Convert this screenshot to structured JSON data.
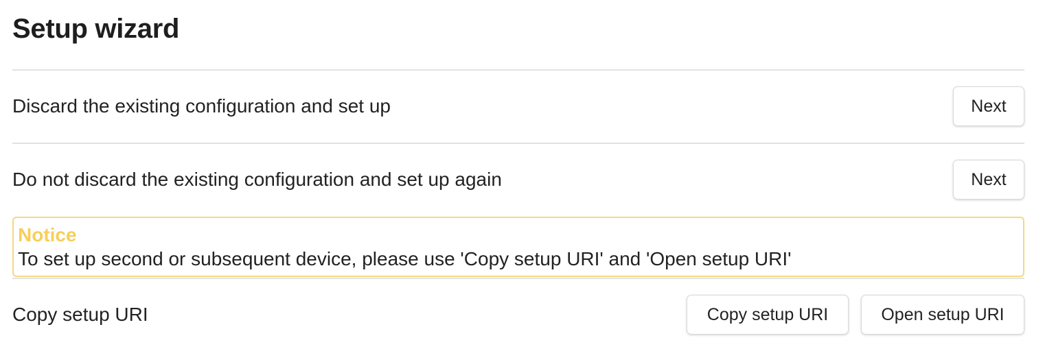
{
  "page": {
    "title": "Setup wizard"
  },
  "rows": [
    {
      "label": "Discard the existing configuration and set up",
      "button": "Next"
    },
    {
      "label": "Do not discard the existing configuration and set up again",
      "button": "Next"
    }
  ],
  "notice": {
    "title": "Notice",
    "text": "To set up second or subsequent device, please use 'Copy setup URI' and 'Open setup URI'"
  },
  "setup_uri": {
    "label": "Copy setup URI",
    "copy_button": "Copy setup URI",
    "open_button": "Open setup URI"
  },
  "colors": {
    "notice_border": "#f5d880",
    "notice_title": "#f6cf5a"
  }
}
